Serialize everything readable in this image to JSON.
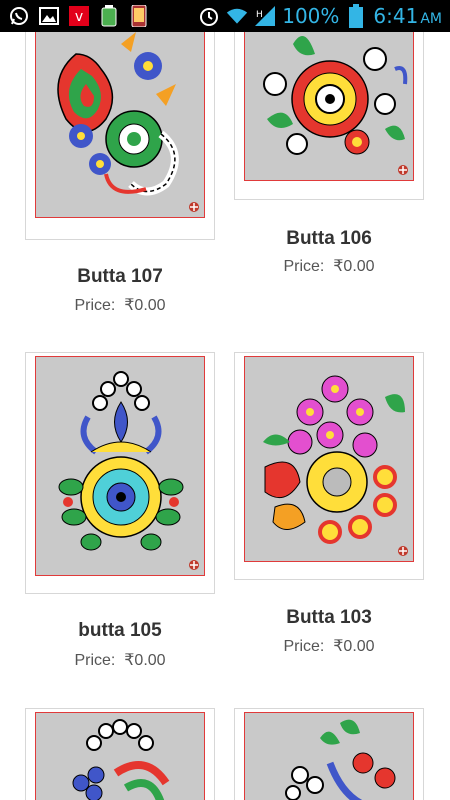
{
  "status_bar": {
    "battery": "100%",
    "time": "6:41",
    "ampm": "AM",
    "icons": [
      "whatsapp-icon",
      "gallery-icon",
      "vodafone-icon",
      "battery-app-icon",
      "phone-app-icon",
      "alarm-icon",
      "wifi-icon",
      "signal-icon",
      "battery-icon"
    ]
  },
  "products": [
    {
      "name": "Butta 107",
      "price_label": "Price:",
      "price": "₹0.00"
    },
    {
      "name": "Butta 106",
      "price_label": "Price:",
      "price": "₹0.00"
    },
    {
      "name": "butta 105",
      "price_label": "Price:",
      "price": "₹0.00"
    },
    {
      "name": "Butta 103",
      "price_label": "Price:",
      "price": "₹0.00"
    }
  ]
}
